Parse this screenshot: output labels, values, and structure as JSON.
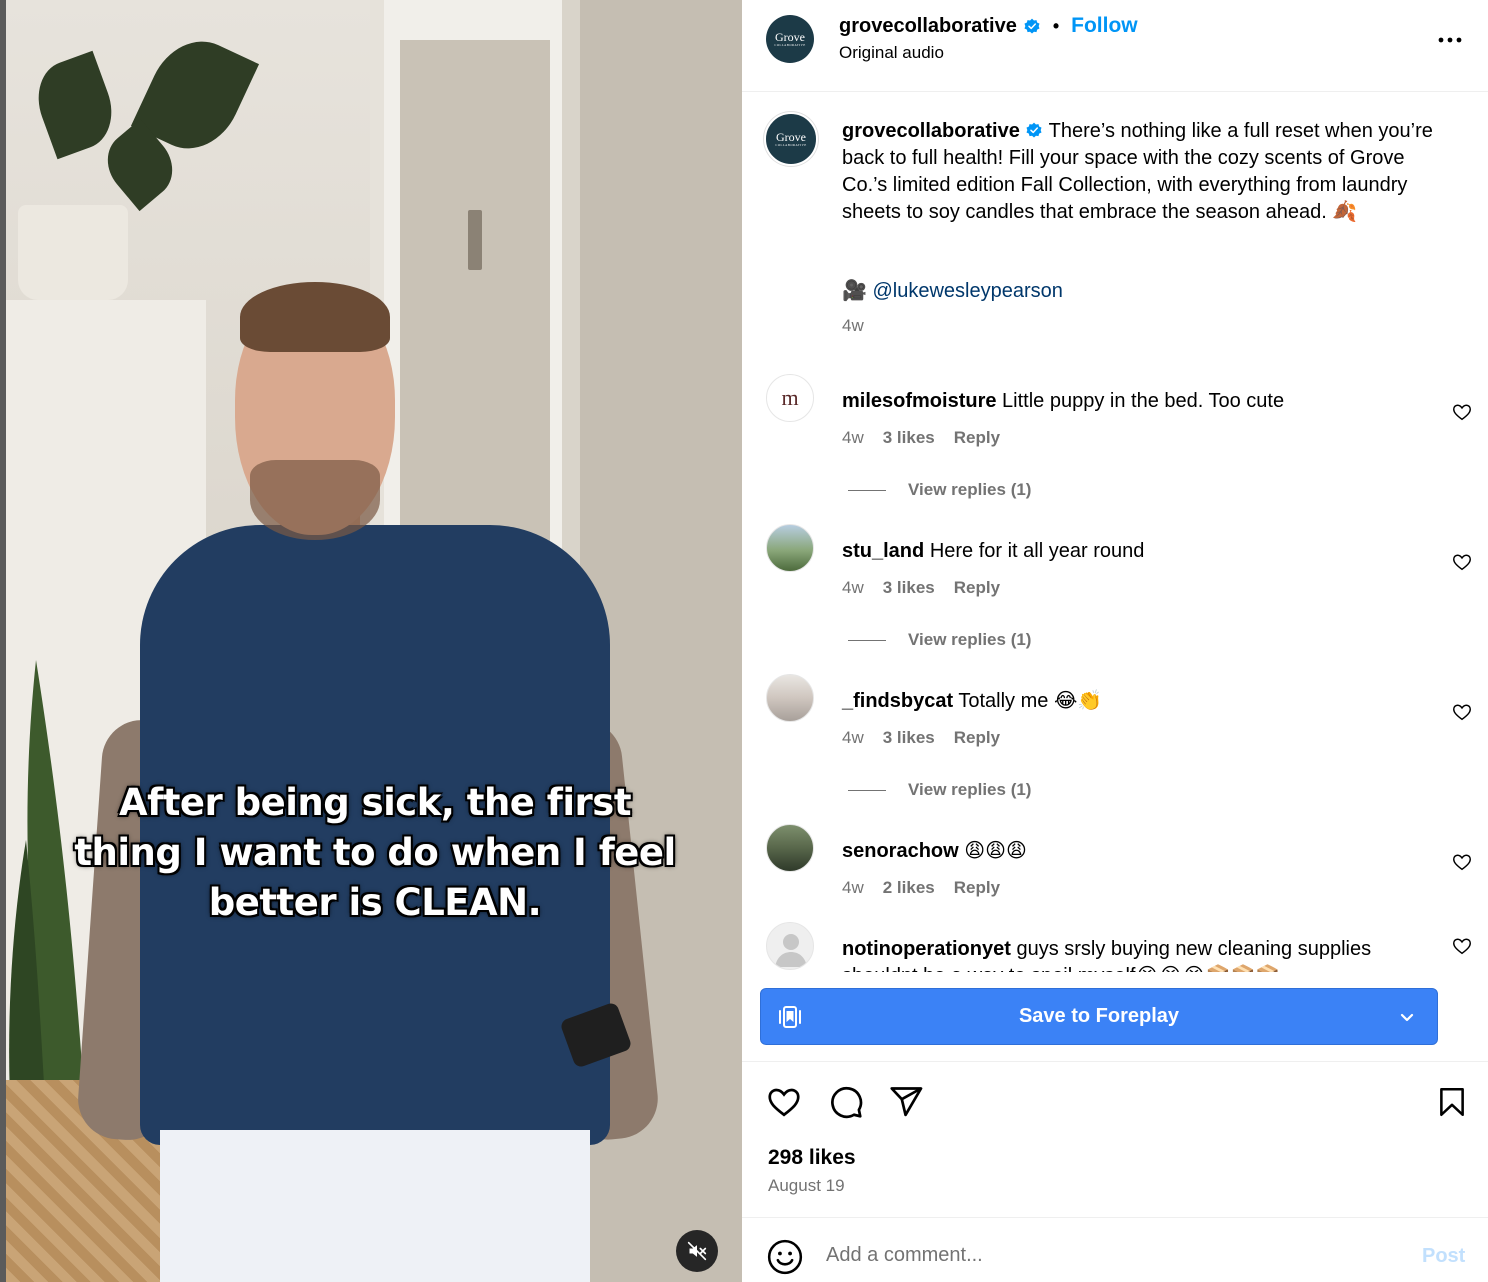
{
  "video": {
    "caption": "After being sick, the first thing I want to do when I feel better is CLEAN.",
    "mute_icon": "muted-speaker-icon"
  },
  "header": {
    "username": "grovecollaborative",
    "separator": "•",
    "follow_label": "Follow",
    "audio_label": "Original audio",
    "more_label": "..."
  },
  "avatar_grove": {
    "line1": "Grove",
    "line2": "COLLABORATIVE"
  },
  "post": {
    "username": "grovecollaborative",
    "caption": "There’s nothing like a full reset when you’re back to full health! Fill your space with the cozy scents of Grove Co.’s limited edition Fall Collection, with everything from laundry sheets to soy candles that embrace the season ahead. 🍂",
    "credit": "🎥 @lukewesleypearson",
    "time": "4w"
  },
  "comments": [
    {
      "username": "milesofmoisture",
      "text": "Little puppy in the bed. Too cute",
      "time": "4w",
      "likes": "3 likes",
      "reply_label": "Reply",
      "view_replies": "View replies (1)"
    },
    {
      "username": "stu_land",
      "text": "Here for it all year round",
      "time": "4w",
      "likes": "3 likes",
      "reply_label": "Reply",
      "view_replies": "View replies (1)"
    },
    {
      "username": "_findsbycat",
      "text": "Totally me 😂👏",
      "time": "4w",
      "likes": "3 likes",
      "reply_label": "Reply",
      "view_replies": "View replies (1)"
    },
    {
      "username": "senorachow",
      "text": "😩😩😩",
      "time": "4w",
      "likes": "2 likes",
      "reply_label": "Reply"
    },
    {
      "username": "notinoperationyet",
      "text": "guys srsly buying new cleaning supplies shouldnt be a way to spoil myself😭😭😭📦📦📦"
    }
  ],
  "miles_avatar_text": "m",
  "save_bar": {
    "label": "Save to Foreplay"
  },
  "actions": {
    "likes": "298 likes",
    "date": "August 19"
  },
  "add_comment": {
    "placeholder": "Add a comment...",
    "post_label": "Post"
  },
  "colors": {
    "accent": "#0095f6",
    "save_bar": "#3b82f6",
    "grove_brand": "#1c3a47",
    "muted_text": "#737373"
  }
}
